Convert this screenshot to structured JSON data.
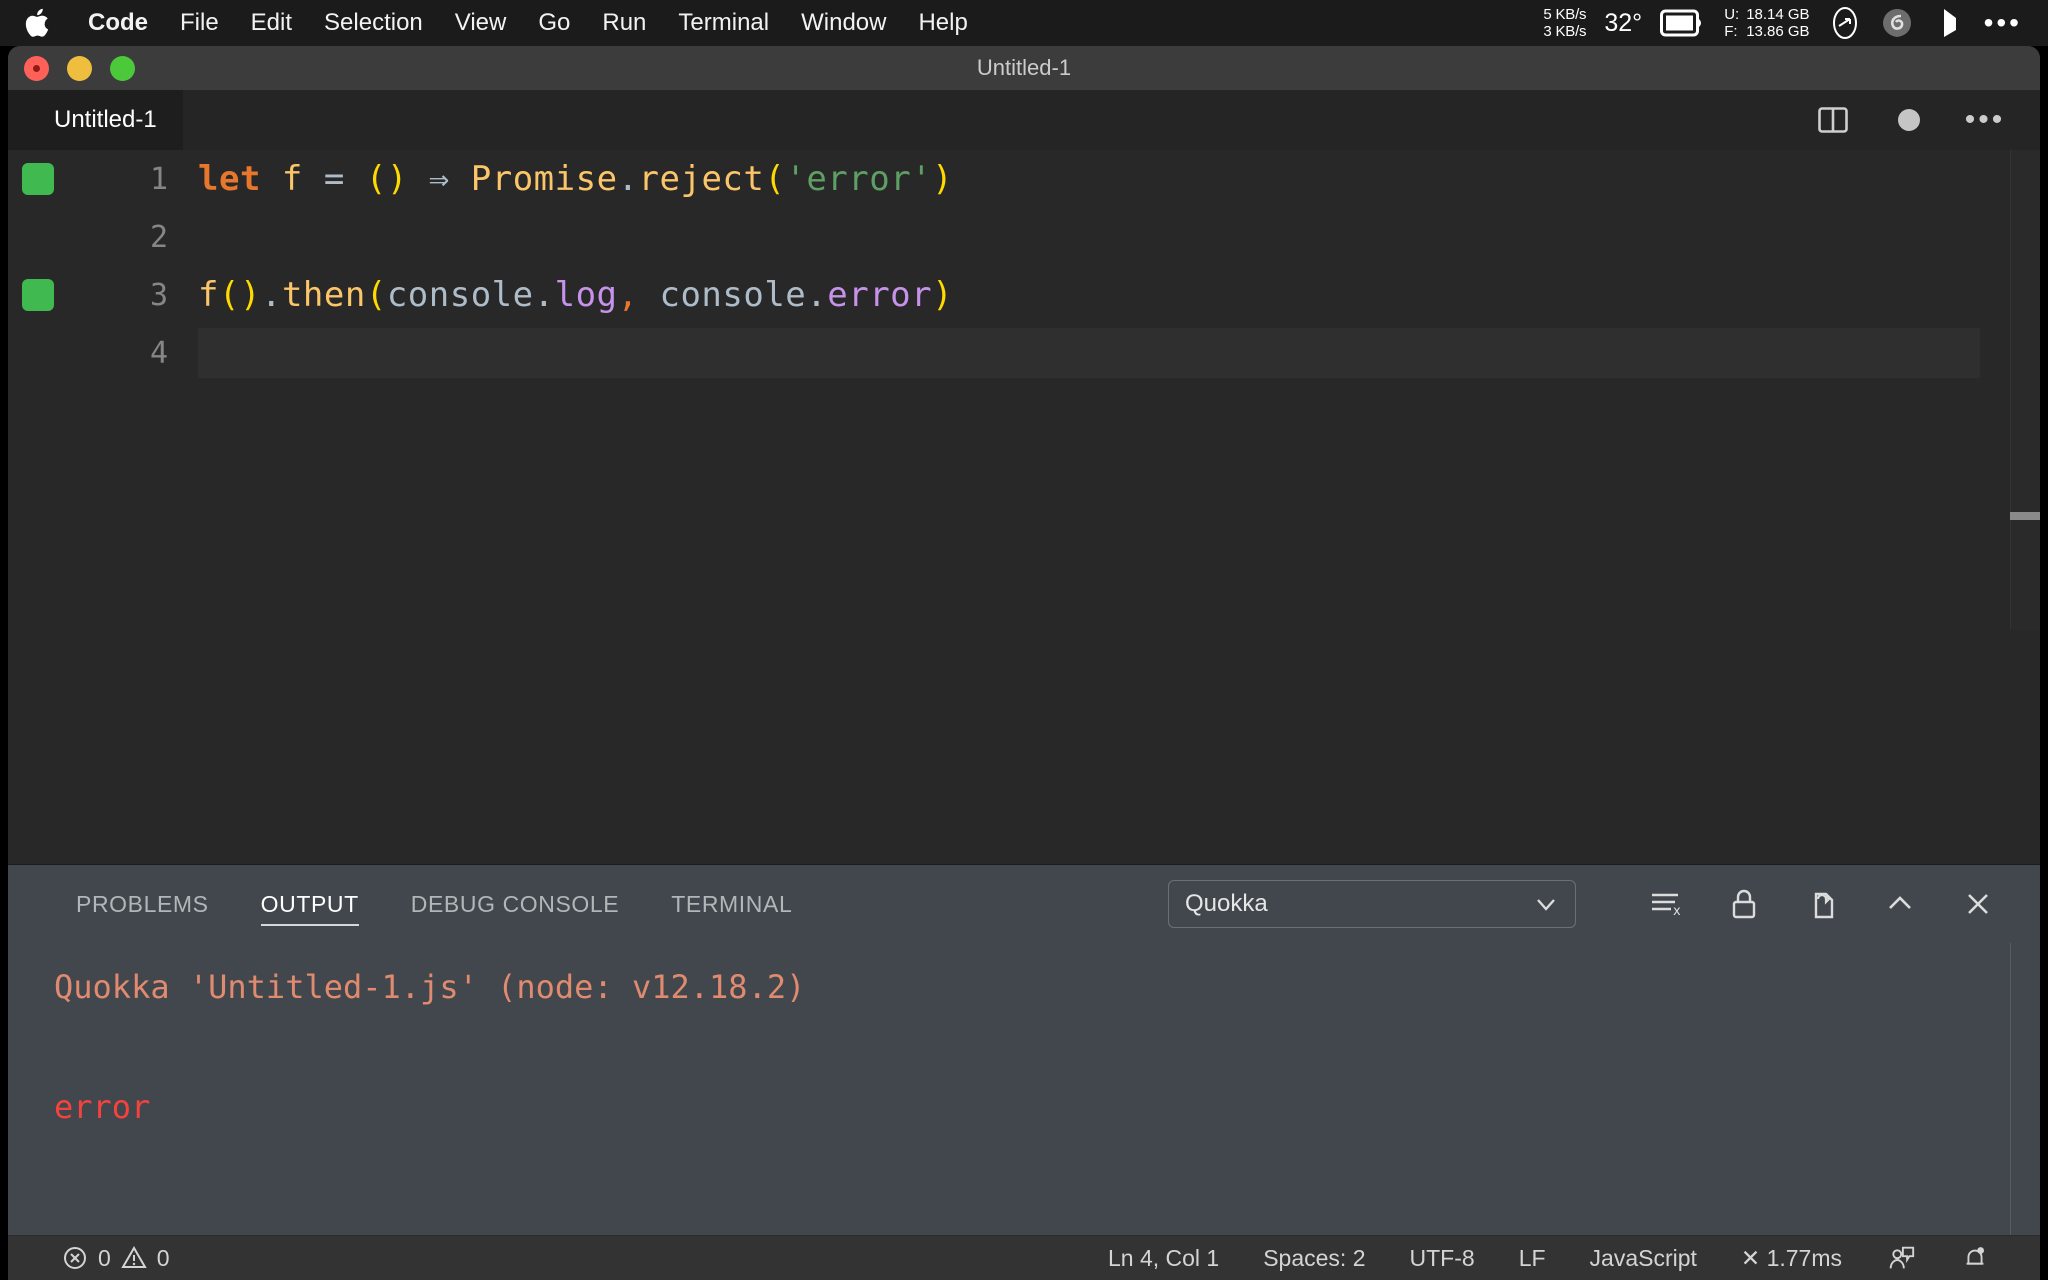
{
  "menubar": {
    "apple_icon": "apple-logo-icon",
    "items": [
      "Code",
      "File",
      "Edit",
      "Selection",
      "View",
      "Go",
      "Run",
      "Terminal",
      "Window",
      "Help"
    ],
    "status": {
      "net_up": "5 KB/s",
      "net_down": "3 KB/s",
      "temperature": "32°",
      "battery_icon": "battery-icon",
      "mem_used_label": "U:",
      "mem_used_value": "18.14 GB",
      "mem_free_label": "F:",
      "mem_free_value": "13.86 GB",
      "extra_icons": [
        "speedometer-icon",
        "spiral-icon",
        "flag-icon",
        "ellipsis-icon"
      ]
    }
  },
  "window": {
    "title": "Untitled-1",
    "traffic_lights": [
      "close-button",
      "minimize-button",
      "maximize-button"
    ]
  },
  "tabbar": {
    "active_tab": "Untitled-1",
    "actions": [
      "split-editor-icon",
      "unsaved-dot-icon",
      "more-actions-icon"
    ]
  },
  "editor": {
    "language": "JavaScript",
    "lines": [
      {
        "number": "1",
        "has_coverage_mark": true,
        "current": false,
        "tokens": [
          {
            "t": "let",
            "c": "t-kw"
          },
          {
            "t": " ",
            "c": "t-plain"
          },
          {
            "t": "f",
            "c": "t-var"
          },
          {
            "t": " ",
            "c": "t-plain"
          },
          {
            "t": "=",
            "c": "t-op"
          },
          {
            "t": " ",
            "c": "t-plain"
          },
          {
            "t": "(",
            "c": "t-paren"
          },
          {
            "t": ")",
            "c": "t-paren"
          },
          {
            "t": " ",
            "c": "t-plain"
          },
          {
            "t": "⇒",
            "c": "t-op"
          },
          {
            "t": " ",
            "c": "t-plain"
          },
          {
            "t": "Promise",
            "c": "t-id"
          },
          {
            "t": ".",
            "c": "t-punc"
          },
          {
            "t": "reject",
            "c": "t-id"
          },
          {
            "t": "(",
            "c": "t-paren"
          },
          {
            "t": "'error'",
            "c": "t-str"
          },
          {
            "t": ")",
            "c": "t-paren"
          }
        ]
      },
      {
        "number": "2",
        "has_coverage_mark": false,
        "current": false,
        "tokens": []
      },
      {
        "number": "3",
        "has_coverage_mark": true,
        "current": false,
        "tokens": [
          {
            "t": "f",
            "c": "t-var"
          },
          {
            "t": "(",
            "c": "t-paren"
          },
          {
            "t": ")",
            "c": "t-paren"
          },
          {
            "t": ".",
            "c": "t-punc"
          },
          {
            "t": "then",
            "c": "t-var"
          },
          {
            "t": "(",
            "c": "t-paren"
          },
          {
            "t": "console",
            "c": "t-prop"
          },
          {
            "t": ".",
            "c": "t-punc"
          },
          {
            "t": "log",
            "c": "t-fn"
          },
          {
            "t": ",",
            "c": "t-comma"
          },
          {
            "t": " ",
            "c": "t-plain"
          },
          {
            "t": "console",
            "c": "t-prop"
          },
          {
            "t": ".",
            "c": "t-punc"
          },
          {
            "t": "error",
            "c": "t-fn"
          },
          {
            "t": ")",
            "c": "t-paren"
          }
        ]
      },
      {
        "number": "4",
        "has_coverage_mark": false,
        "current": true,
        "tokens": []
      }
    ]
  },
  "panel": {
    "tabs": [
      {
        "label": "PROBLEMS",
        "active": false
      },
      {
        "label": "OUTPUT",
        "active": true
      },
      {
        "label": "DEBUG CONSOLE",
        "active": false
      },
      {
        "label": "TERMINAL",
        "active": false
      }
    ],
    "channel_select": {
      "value": "Quokka",
      "chevron": "chevron-down-icon"
    },
    "actions": [
      "clear-output-icon",
      "lock-scroll-icon",
      "open-in-editor-icon",
      "collapse-panel-icon",
      "close-panel-icon"
    ],
    "output": [
      {
        "text": "Quokka 'Untitled-1.js' (node: v12.18.2)",
        "cls": "out-head"
      },
      {
        "text": "",
        "cls": "out-blank"
      },
      {
        "text": "error",
        "cls": "out-err"
      }
    ]
  },
  "statusbar": {
    "errors_icon": "error-circle-icon",
    "errors": "0",
    "warnings_icon": "warning-triangle-icon",
    "warnings": "0",
    "cursor": "Ln 4, Col 1",
    "indentation": "Spaces: 2",
    "encoding": "UTF-8",
    "eol": "LF",
    "language": "JavaScript",
    "quokka_time": "✕ 1.77ms",
    "feedback_icon": "feedback-icon",
    "bell_icon": "bell-icon"
  },
  "colors": {
    "editor_bg": "#282828",
    "panel_bg": "#41474c",
    "statusbar_bg": "#333333",
    "coverage_green": "#3fb950",
    "output_head": "#e08a70",
    "output_error": "#f4433c"
  }
}
